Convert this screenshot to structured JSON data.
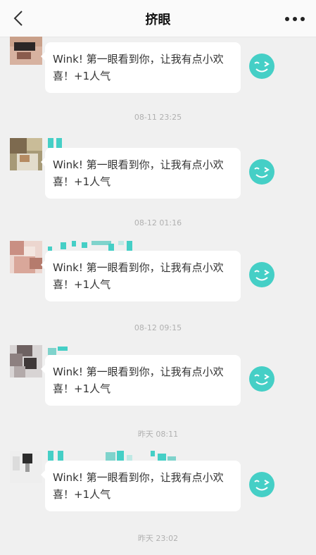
{
  "header": {
    "title": "挤眼",
    "back_icon": "chevron-left-icon",
    "more_icon": "more-dots-icon"
  },
  "messages": [
    {
      "text": "Wink! 第一眼看到你，让我有点小欢喜！+1人气"
    },
    {
      "text": "Wink! 第一眼看到你，让我有点小欢喜！+1人气"
    },
    {
      "text": "Wink! 第一眼看到你，让我有点小欢喜！+1人气"
    },
    {
      "text": "Wink! 第一眼看到你，让我有点小欢喜！+1人气"
    },
    {
      "text": "Wink! 第一眼看到你，让我有点小欢喜！+1人气"
    }
  ],
  "timestamps": [
    "08-11 23:25",
    "08-12 01:16",
    "08-12 09:15",
    "昨天 08:11",
    "昨天 23:02"
  ],
  "colors": {
    "accent": "#45cfc6",
    "background": "#f0f0f0",
    "bubble": "#ffffff"
  }
}
